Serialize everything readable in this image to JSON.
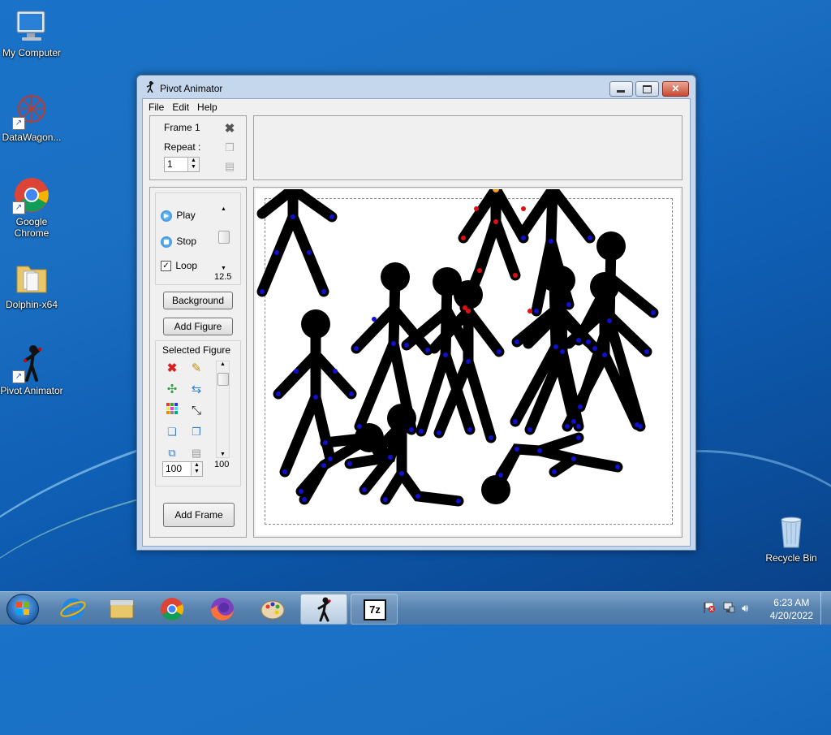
{
  "desktop": {
    "icons": [
      {
        "label": "My Computer"
      },
      {
        "label": "DataWagon..."
      },
      {
        "label": "Google Chrome"
      },
      {
        "label": "Dolphin-x64"
      },
      {
        "label": "Pivot Animator"
      },
      {
        "label": "Recycle Bin"
      }
    ]
  },
  "window": {
    "title": "Pivot Animator",
    "menu": [
      "File",
      "Edit",
      "Help"
    ],
    "frame_panel": {
      "frame_label": "Frame 1",
      "repeat_label": "Repeat :",
      "repeat_value": "1"
    },
    "playback": {
      "play": "Play",
      "stop": "Stop",
      "loop": "Loop",
      "loop_checked": true,
      "speed": "12.5"
    },
    "buttons": {
      "background": "Background",
      "add_figure": "Add Figure",
      "add_frame": "Add Frame"
    },
    "selected_figure": {
      "label": "Selected Figure",
      "scale_value": "100",
      "scroll_value": "100"
    }
  },
  "taskbar": {
    "time": "6:23 AM",
    "date": "4/20/2022",
    "items": [
      "start-button",
      "internet-explorer",
      "file-explorer",
      "chrome",
      "firefox",
      "paint",
      "pivot-animator",
      "7zip"
    ]
  },
  "colors": {
    "joint_blue": "#1010d0",
    "joint_red": "#e01010",
    "handle_orange": "#f0a020"
  }
}
